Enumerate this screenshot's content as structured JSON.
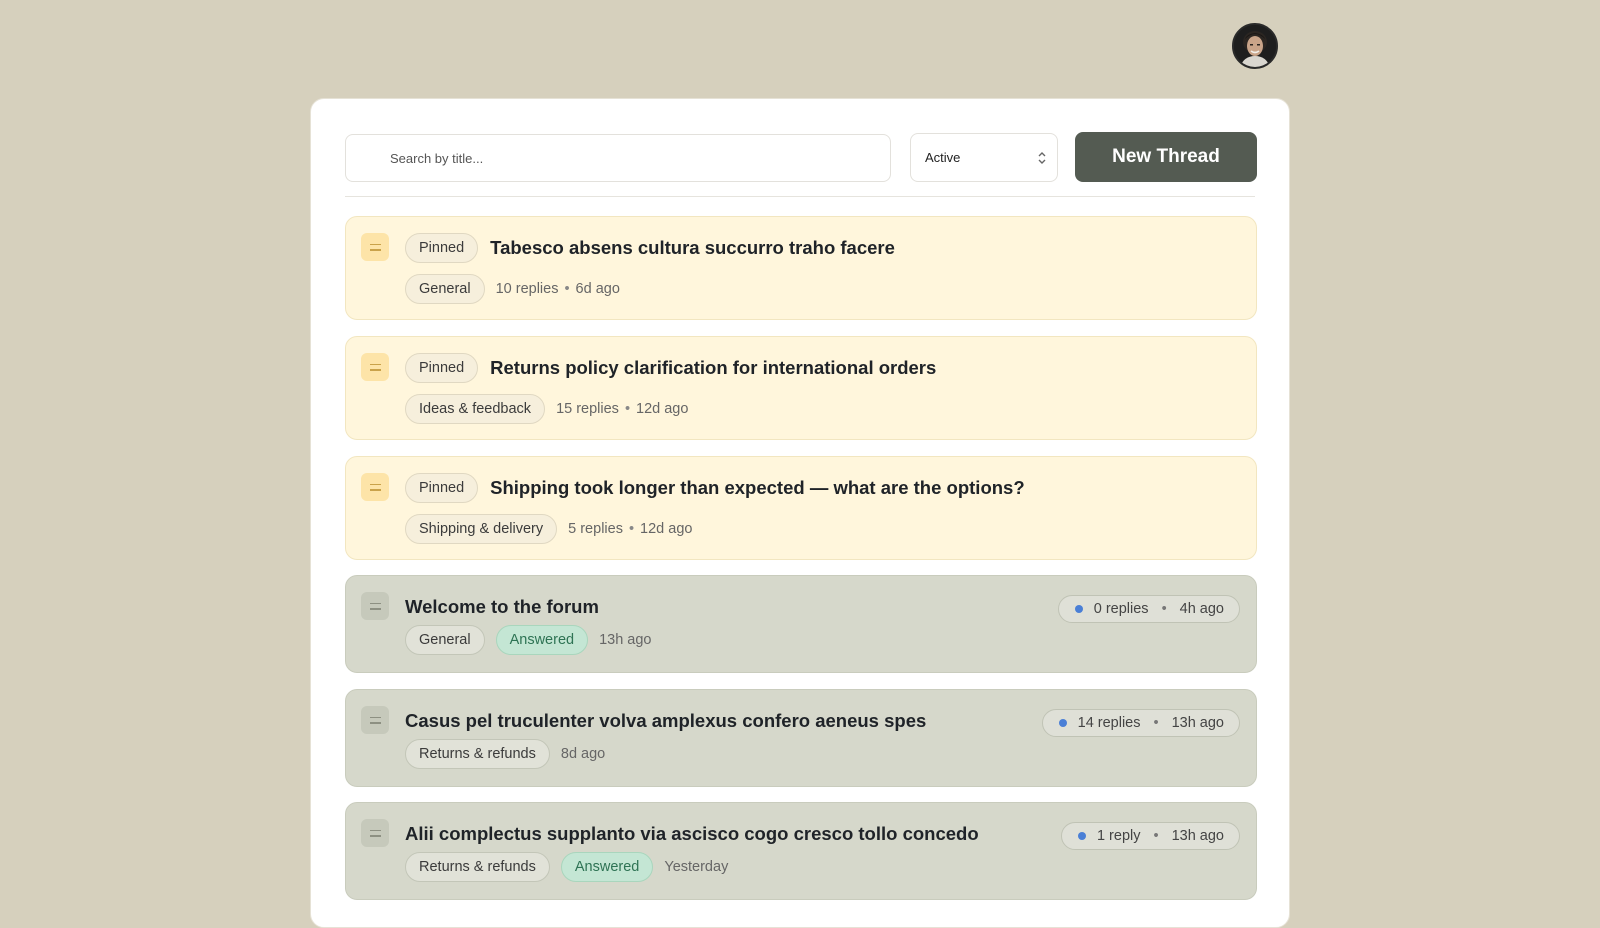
{
  "header": {
    "avatar_label": "User avatar"
  },
  "toolbar": {
    "search_placeholder": "Search by title...",
    "filter_value": "Active",
    "new_thread_label": "New Thread"
  },
  "threads": [
    {
      "pinned_label": "Pinned",
      "title": "Tabesco absens cultura succurro traho facere",
      "category": "General",
      "replies": "10 replies",
      "age": "6d ago"
    },
    {
      "pinned_label": "Pinned",
      "title": "Returns policy clarification for international orders",
      "category": "Ideas & feedback",
      "replies": "15 replies",
      "age": "12d ago"
    },
    {
      "pinned_label": "Pinned",
      "title": "Shipping took longer than expected — what are the options?",
      "category": "Shipping & delivery",
      "replies": "5 replies",
      "age": "12d ago"
    },
    {
      "title": "Welcome to the forum",
      "category": "General",
      "status": "Answered",
      "created": "13h ago",
      "replies": "0 replies",
      "last_activity": "4h ago"
    },
    {
      "title": "Casus pel truculenter volva amplexus confero aeneus spes",
      "category": "Returns & refunds",
      "created": "8d ago",
      "replies": "14 replies",
      "last_activity": "13h ago"
    },
    {
      "title": "Alii complectus supplanto via ascisco cogo cresco tollo concedo",
      "category": "Returns & refunds",
      "status": "Answered",
      "created": "Yesterday",
      "replies": "1 reply",
      "last_activity": "13h ago"
    }
  ],
  "separator": "•",
  "colors": {
    "background": "#d6d0bd",
    "pinned_card": "#fff6dc",
    "normal_card": "#d6d8cb",
    "primary_button": "#545b52",
    "answered_badge": "#c4e6d4",
    "unread_dot": "#4a7fd6"
  },
  "icons": {
    "drag_handle": "drag-handle-icon",
    "search": "search-icon",
    "select_chevron": "chevron-updown-icon"
  }
}
